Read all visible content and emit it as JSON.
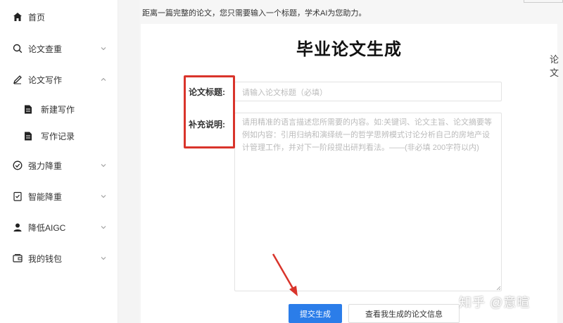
{
  "sidebar": {
    "items": [
      {
        "label": "首页",
        "icon": "home-icon"
      },
      {
        "label": "论文查重",
        "icon": "search-icon"
      },
      {
        "label": "论文写作",
        "icon": "pen-icon"
      },
      {
        "label": "新建写作",
        "icon": "document-icon"
      },
      {
        "label": "写作记录",
        "icon": "document-icon"
      },
      {
        "label": "强力降重",
        "icon": "check-circle-icon"
      },
      {
        "label": "智能降重",
        "icon": "checklist-icon"
      },
      {
        "label": "降低AIGC",
        "icon": "user-icon"
      },
      {
        "label": "我的钱包",
        "icon": "wallet-icon"
      }
    ]
  },
  "main": {
    "notice": "距离一篇完整的论文，您只需要输入一个标题，学术AI为您助力。",
    "title": "毕业论文生成",
    "form": {
      "title_label": "论文标题:",
      "title_placeholder": "请输入论文标题（必填）",
      "desc_label": "补充说明:",
      "desc_placeholder": "请用精准的语言描述您所需要的内容。如:关键词、论文主旨、论文摘要等例如内容：引用归纳和演绎统一的哲学思辨模式讨论分析自己的房地产设计管理工作，并对下一阶段提出研判看法。——(非必填 200字符以内)"
    },
    "buttons": {
      "submit": "提交生成",
      "view": "查看我生成的论文信息"
    }
  },
  "right_edge_text": "论文",
  "watermark": "知乎 @意暄",
  "colors": {
    "primary": "#2b7de9",
    "highlight": "#d9342b",
    "arrow": "#d9342b"
  }
}
